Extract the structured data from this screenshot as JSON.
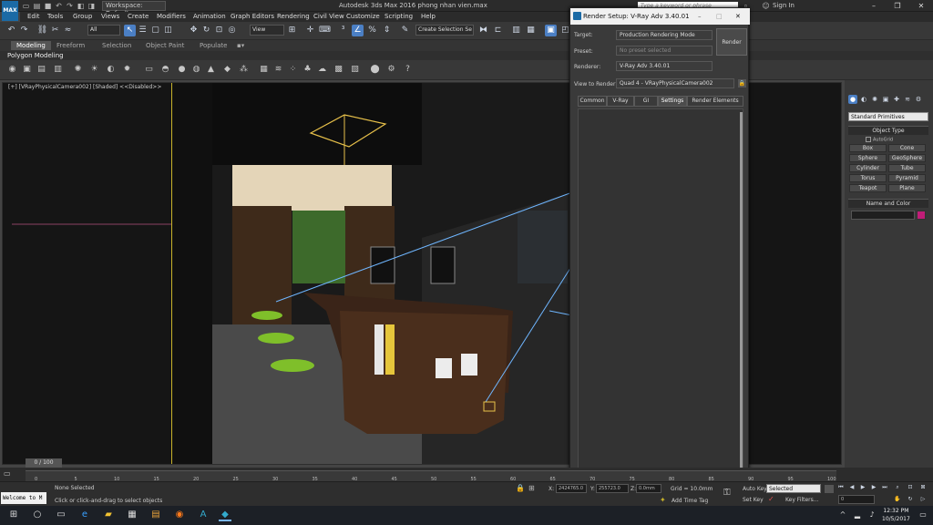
{
  "window": {
    "title": "Autodesk 3ds Max 2016    phong nhan vien.max",
    "workspace": "Workspace: Default",
    "search_placeholder": "Type a keyword or phrase",
    "sign_in": "Sign In",
    "logo_text": "MAX"
  },
  "menu": [
    "Edit",
    "Tools",
    "Group",
    "Views",
    "Create",
    "Modifiers",
    "Animation",
    "Graph Editors",
    "Rendering",
    "Civil View",
    "Customize",
    "Scripting",
    "Help"
  ],
  "toolbar": {
    "filter": "All",
    "view": "View",
    "selection_set": "Create Selection Se"
  },
  "ribbon": {
    "tabs": [
      "Modeling",
      "Freeform",
      "Selection",
      "Object Paint",
      "Populate"
    ],
    "sub": "Polygon Modeling"
  },
  "viewport": {
    "label": "[+] [VRayPhysicalCamera002] [Shaded] <<Disabled>>"
  },
  "command_panel": {
    "dropdown": "Standard Primitives",
    "object_type": "Object Type",
    "autogrid": "AutoGrid",
    "buttons": [
      "Box",
      "Cone",
      "Sphere",
      "GeoSphere",
      "Cylinder",
      "Tube",
      "Torus",
      "Pyramid",
      "Teapot",
      "Plane"
    ],
    "name_color": "Name and Color",
    "swatch_color": "#c01d78"
  },
  "render_setup": {
    "title": "Render Setup: V-Ray Adv 3.40.01",
    "target_label": "Target:",
    "target_value": "Production Rendering Mode",
    "preset_label": "Preset:",
    "preset_value": "No preset selected",
    "renderer_label": "Renderer:",
    "renderer_value": "V-Ray Adv 3.40.01",
    "view_label": "View to Render:",
    "view_value": "Quad 4 - VRayPhysicalCamera002",
    "render_button": "Render",
    "tabs": [
      "Common",
      "V-Ray",
      "GI",
      "Settings",
      "Render Elements"
    ]
  },
  "timeline": {
    "frame": "0 / 100",
    "ticks": [
      "0",
      "5",
      "10",
      "15",
      "20",
      "25",
      "30",
      "35",
      "40",
      "45",
      "50",
      "55",
      "60",
      "65",
      "70",
      "75",
      "80",
      "85",
      "90",
      "95",
      "100"
    ]
  },
  "status": {
    "maxscript": "Welcome to M",
    "selected": "None Selected",
    "prompt": "Click or click-and-drag to select objects",
    "x_label": "X:",
    "x_value": "2424765.0",
    "y_label": "Y:",
    "y_value": "255723.0",
    "z_label": "Z:",
    "z_value": "0.0mm",
    "grid": "Grid = 10.0mm",
    "add_time_tag": "Add Time Tag",
    "auto_key": "Auto Key",
    "set_key": "Set Key",
    "key_mode": "Selected",
    "key_filters": "Key Filters...",
    "frame_field": "0"
  },
  "taskbar": {
    "time": "12:32 PM",
    "date": "10/5/2017"
  }
}
